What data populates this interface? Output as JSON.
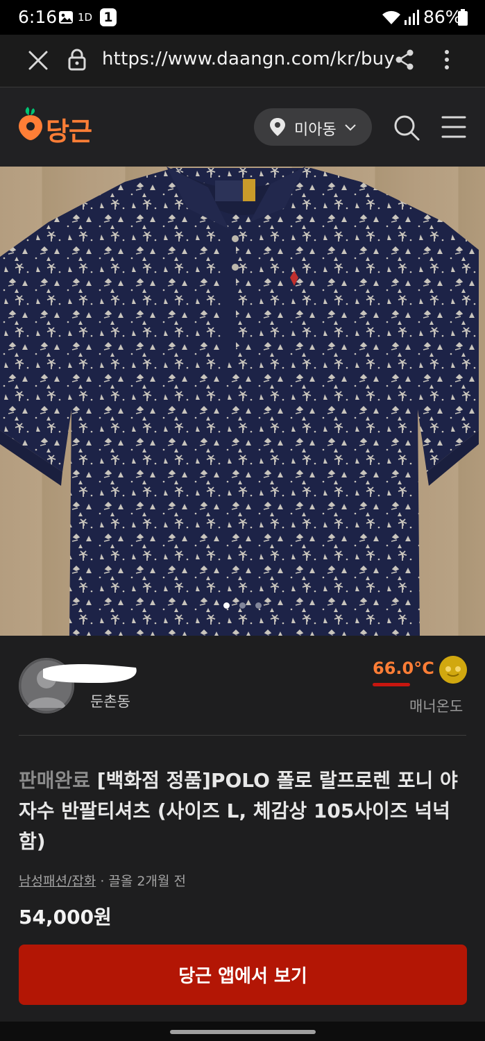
{
  "status_bar": {
    "time": "6:16",
    "battery": "86%",
    "badge": "1",
    "sim_label": "1D"
  },
  "browser": {
    "url": "https://www.daangn.com/kr/buy"
  },
  "header": {
    "logo": "당근",
    "location": "미아동",
    "brand_color": "#ff7e36"
  },
  "gallery": {
    "total": 3,
    "active_index": 0
  },
  "seller": {
    "location": "둔촌동",
    "temperature": "66.0°C",
    "temperature_label": "매너온도",
    "name_redacted": true
  },
  "listing": {
    "status": "판매완료",
    "title": "[백화점 정품]POLO 폴로 랄프로렌 포니 야자수 반팔티셔츠 (사이즈 L, 체감상 105사이즈 넉넉함)",
    "category": "남성패션/잡화",
    "time_sep": " · 끌올 2개월 전",
    "price": "54,000원",
    "cta_label": "당근 앱에서 보기",
    "cta_color": "#b31605"
  }
}
